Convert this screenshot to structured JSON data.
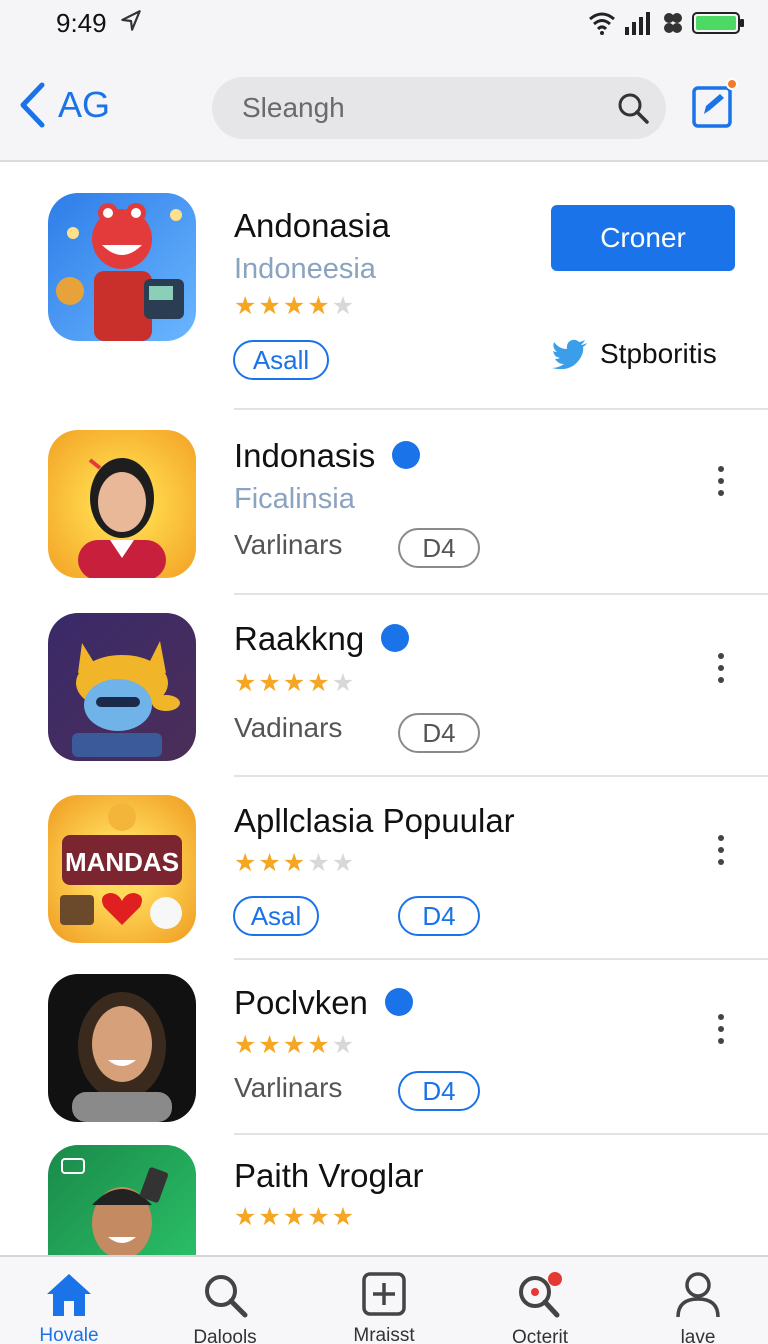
{
  "status": {
    "time": "9:49"
  },
  "header": {
    "back_label": "AG",
    "search_placeholder": "Sleangh"
  },
  "apps": [
    {
      "name": "Andonasia",
      "subtitle": "Indoneesia",
      "rating": 4,
      "tag": "Asall",
      "action": "Croner",
      "social": "Stpboritis"
    },
    {
      "name": "Indonasis",
      "subtitle": "Ficalinsia",
      "meta": "Varlinars",
      "badge": "D4"
    },
    {
      "name": "Raakkng",
      "rating": 4,
      "meta": "Vadinars",
      "badge": "D4"
    },
    {
      "name": "Apllclasia Popuular",
      "rating": 3,
      "tag": "Asal",
      "badge": "D4",
      "icon_text": "MANDAS"
    },
    {
      "name": "Poclvken",
      "rating": 4,
      "meta": "Varlinars",
      "badge": "D4"
    },
    {
      "name": "Paith Vroglar",
      "rating": 4.5
    }
  ],
  "tabs": [
    {
      "label": "Hovale",
      "icon": "home-icon",
      "active": true
    },
    {
      "label": "Dalools",
      "icon": "search-icon",
      "active": false
    },
    {
      "label": "Mraisst",
      "icon": "add-box-icon",
      "active": false
    },
    {
      "label": "Octerit",
      "icon": "search-badge-icon",
      "active": false
    },
    {
      "label": "lave",
      "icon": "person-icon",
      "active": false
    }
  ],
  "colors": {
    "accent": "#1a73e8",
    "star": "#f5a623",
    "badge": "#f57c24"
  }
}
